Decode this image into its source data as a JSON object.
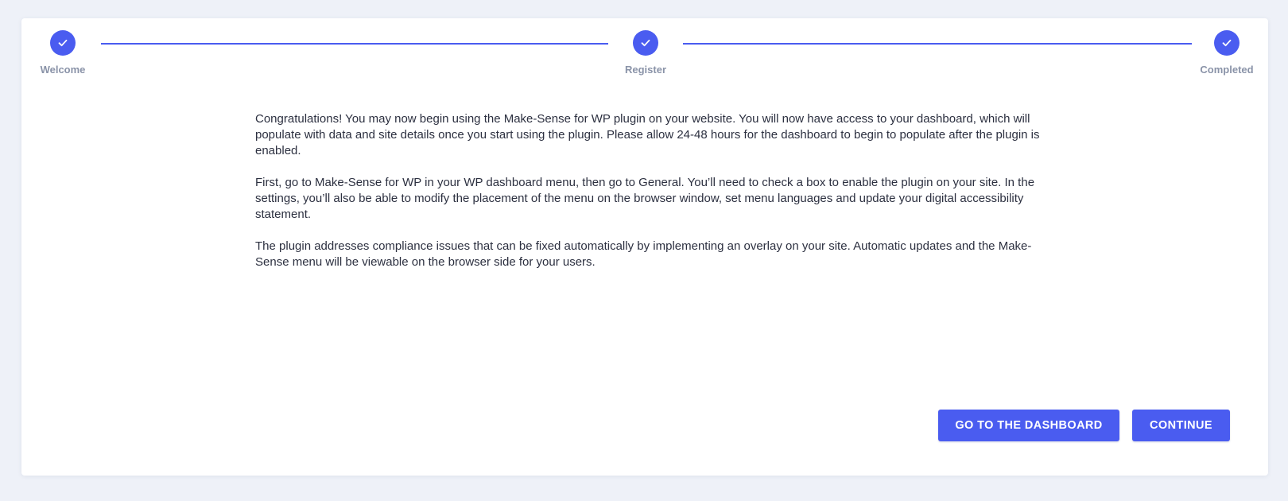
{
  "stepper": {
    "steps": [
      {
        "label": "Welcome",
        "completed": true,
        "icon": "check-icon"
      },
      {
        "label": "Register",
        "completed": true,
        "icon": "check-icon"
      },
      {
        "label": "Completed",
        "completed": true,
        "icon": "check-icon"
      }
    ]
  },
  "content": {
    "paragraphs": [
      "Congratulations! You may now begin using the Make-Sense for WP plugin on your website. You will now have access to your dashboard, which will populate with data and site details once you start using the plugin. Please allow 24-48 hours for the dashboard to begin to populate after the plugin is enabled.",
      "First, go to Make-Sense for WP in your WP dashboard menu, then go to General. You’ll need to check a box to enable the plugin on your site. In the settings, you’ll also be able to modify the placement of the menu on the browser window, set menu languages and update your digital accessibility statement.",
      "The plugin addresses compliance issues that can be fixed automatically by implementing an overlay on your site. Automatic updates and the Make-Sense menu will be viewable on the browser side for your users."
    ]
  },
  "actions": {
    "dashboard_label": "GO TO THE DASHBOARD",
    "continue_label": "CONTINUE"
  },
  "colors": {
    "accent": "#4a5cf0",
    "background": "#eef1f8",
    "step_label": "#8a93a8",
    "text": "#2c3040"
  }
}
